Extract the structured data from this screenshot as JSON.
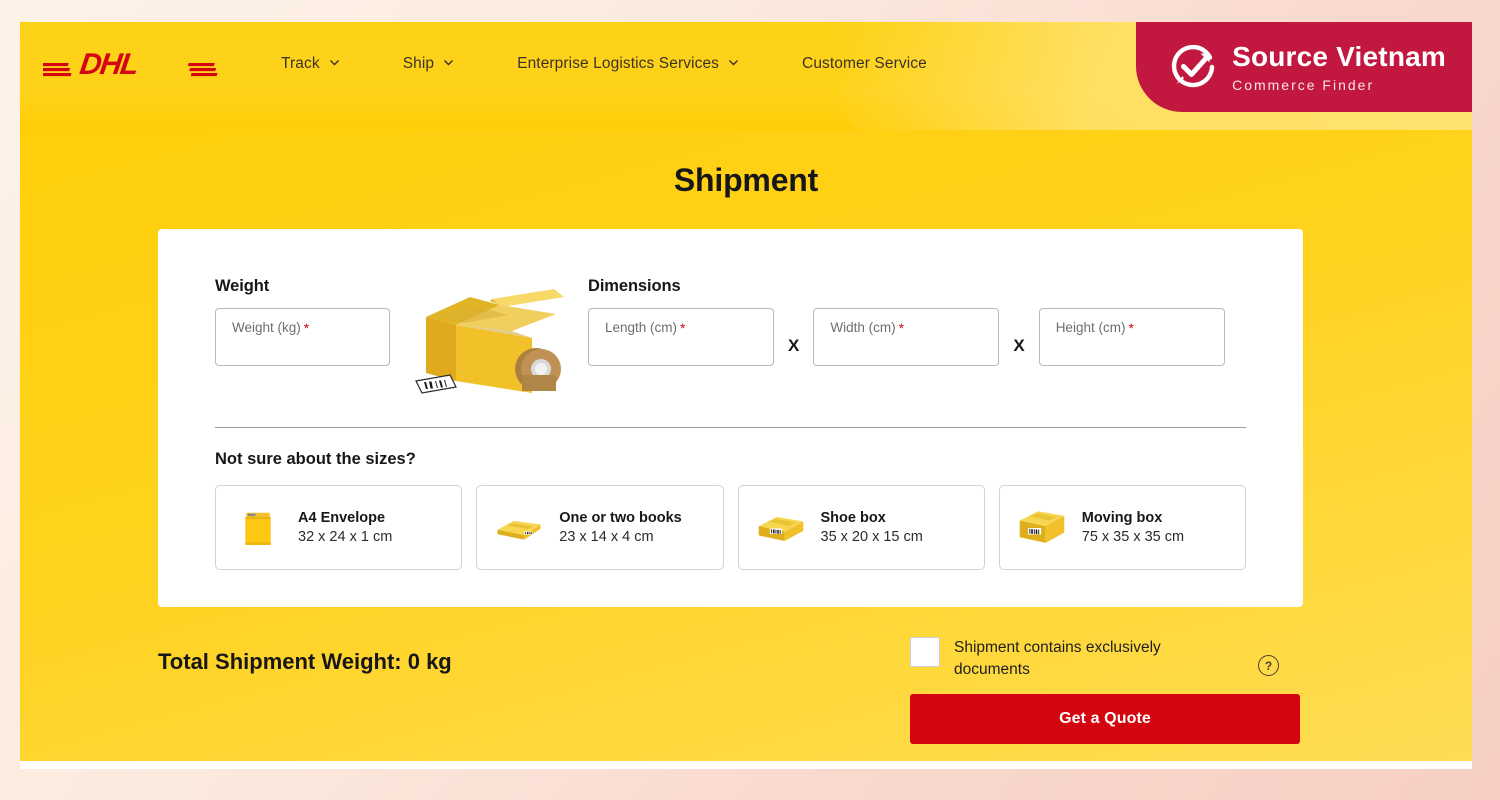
{
  "brand": {
    "logo_text": "DHL",
    "logo_alt": "dhl-logo"
  },
  "nav": {
    "items": [
      {
        "label": "Track",
        "has_dropdown": true
      },
      {
        "label": "Ship",
        "has_dropdown": true
      },
      {
        "label": "Enterprise Logistics Services",
        "has_dropdown": true
      },
      {
        "label": "Customer Service",
        "has_dropdown": false
      }
    ]
  },
  "watermark": {
    "title": "Source Vietnam",
    "subtitle": "Commerce Finder",
    "bg_color": "#c2173f",
    "text_color": "#ffffff"
  },
  "hero": {
    "title": "Shipment",
    "bg_color": "#ffcc00"
  },
  "form": {
    "weight": {
      "label": "Weight",
      "placeholder": "Weight (kg)",
      "required_mark": "*",
      "value": ""
    },
    "dimensions": {
      "label": "Dimensions",
      "separator": "X",
      "fields": [
        {
          "name": "length",
          "placeholder": "Length (cm)",
          "required_mark": "*",
          "value": ""
        },
        {
          "name": "width",
          "placeholder": "Width (cm)",
          "required_mark": "*",
          "value": ""
        },
        {
          "name": "height",
          "placeholder": "Height (cm)",
          "required_mark": "*",
          "value": ""
        }
      ]
    },
    "sizes": {
      "title": "Not sure about the sizes?",
      "presets": [
        {
          "icon": "envelope-icon",
          "name": "A4 Envelope",
          "dims": "32 x 24 x 1 cm"
        },
        {
          "icon": "flat-box-icon",
          "name": "One or two books",
          "dims": "23 x 14 x 4 cm"
        },
        {
          "icon": "shoe-box-icon",
          "name": "Shoe box",
          "dims": "35 x 20 x 15 cm"
        },
        {
          "icon": "moving-box-icon",
          "name": "Moving box",
          "dims": "75 x 35 x 35 cm"
        }
      ]
    }
  },
  "footer": {
    "total_weight": "Total Shipment Weight: 0 kg",
    "documents_checkbox": {
      "label": "Shipment contains exclusively documents",
      "checked": false
    },
    "help_icon_glyph": "?",
    "quote_button": {
      "label": "Get a Quote",
      "color": "#d40511"
    }
  },
  "colors": {
    "dhl_yellow": "#ffcc00",
    "dhl_red": "#d40511",
    "page_bg": "#fbeade",
    "card_bg": "#ffffff"
  }
}
